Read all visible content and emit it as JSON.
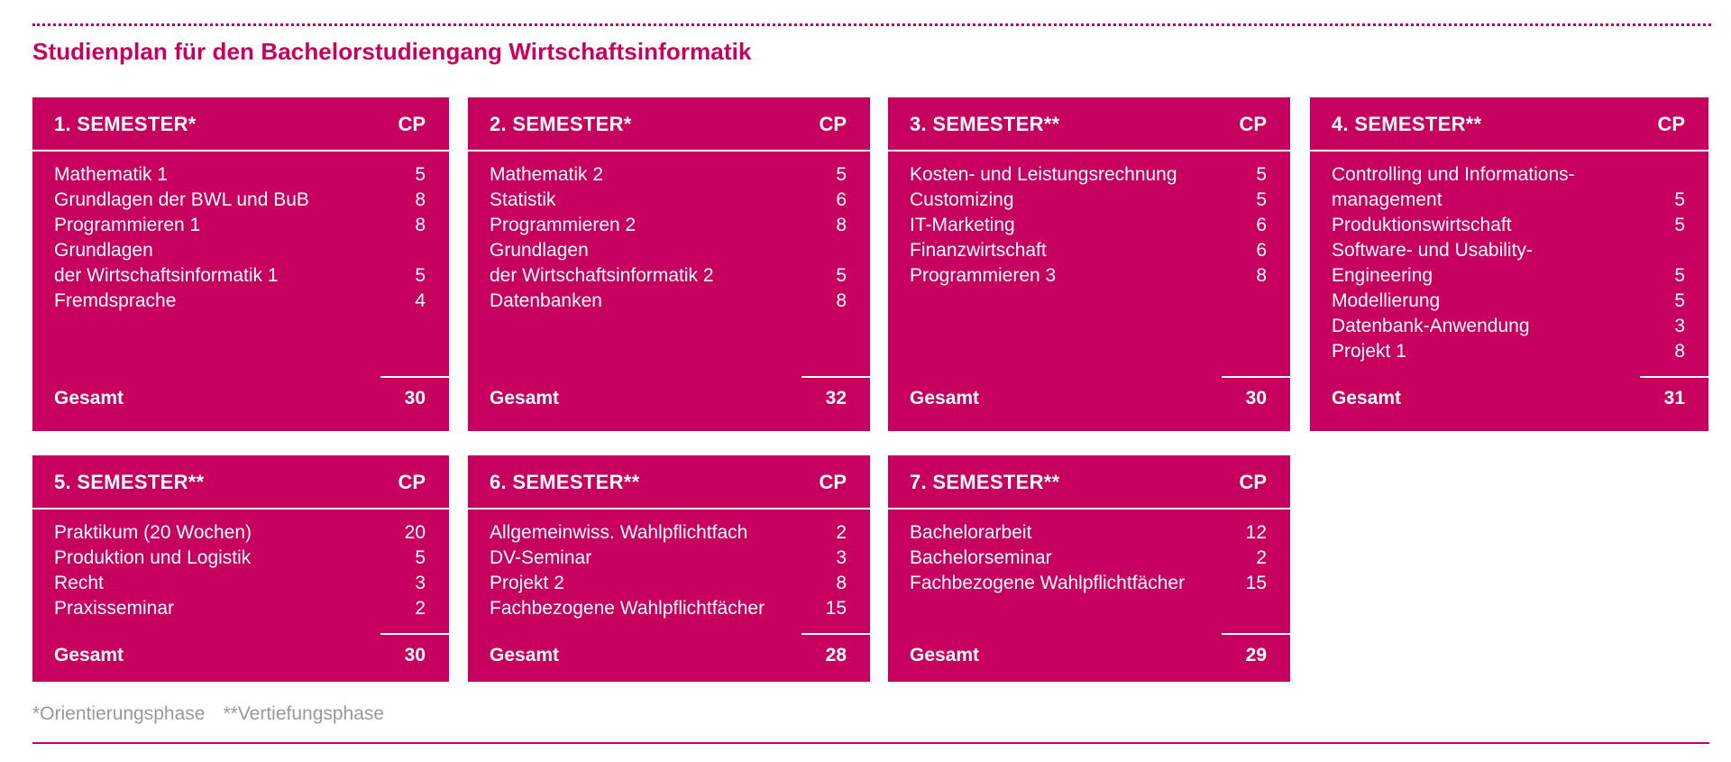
{
  "title": "Studienplan für den Bachelorstudiengang Wirtschaftsinformatik",
  "cp_header": "CP",
  "total_label": "Gesamt",
  "colors": {
    "accent": "#c7005f",
    "text_on_accent": "#ffffff",
    "footnote": "#999999"
  },
  "semesters": [
    {
      "title": "1. SEMESTER*",
      "courses": [
        {
          "name": "Mathematik 1",
          "cp": "5"
        },
        {
          "name": "Grundlagen der BWL und BuB",
          "cp": "8"
        },
        {
          "name": "Programmieren 1",
          "cp": "8"
        },
        {
          "name": "Grundlagen\nder Wirtschaftsinformatik 1",
          "cp": "5"
        },
        {
          "name": "Fremdsprache",
          "cp": "4"
        }
      ],
      "total": "30"
    },
    {
      "title": "2. SEMESTER*",
      "courses": [
        {
          "name": "Mathematik 2",
          "cp": "5"
        },
        {
          "name": "Statistik",
          "cp": "6"
        },
        {
          "name": "Programmieren 2",
          "cp": "8"
        },
        {
          "name": "Grundlagen\nder Wirtschaftsinformatik 2",
          "cp": "5"
        },
        {
          "name": "Datenbanken",
          "cp": "8"
        }
      ],
      "total": "32"
    },
    {
      "title": "3. SEMESTER**",
      "courses": [
        {
          "name": "Kosten- und Leistungsrechnung",
          "cp": "5"
        },
        {
          "name": "Customizing",
          "cp": "5"
        },
        {
          "name": "IT-Marketing",
          "cp": "6"
        },
        {
          "name": "Finanzwirtschaft",
          "cp": "6"
        },
        {
          "name": "Programmieren 3",
          "cp": "8"
        }
      ],
      "total": "30"
    },
    {
      "title": "4. SEMESTER**",
      "courses": [
        {
          "name": "Controlling und Informations-\nmanagement",
          "cp": "5"
        },
        {
          "name": "Produktionswirtschaft",
          "cp": "5"
        },
        {
          "name": "Software- und Usability-\nEngineering",
          "cp": "5"
        },
        {
          "name": "Modellierung",
          "cp": "5"
        },
        {
          "name": "Datenbank-Anwendung",
          "cp": "3"
        },
        {
          "name": "Projekt 1",
          "cp": "8"
        }
      ],
      "total": "31"
    },
    {
      "title": "5. SEMESTER**",
      "courses": [
        {
          "name": "Praktikum (20 Wochen)",
          "cp": "20"
        },
        {
          "name": "Produktion und Logistik",
          "cp": "5"
        },
        {
          "name": "Recht",
          "cp": "3"
        },
        {
          "name": "Praxisseminar",
          "cp": "2"
        }
      ],
      "total": "30"
    },
    {
      "title": "6. SEMESTER**",
      "courses": [
        {
          "name": "Allgemeinwiss. Wahlpflichtfach",
          "cp": "2"
        },
        {
          "name": "DV-Seminar",
          "cp": "3"
        },
        {
          "name": "Projekt 2",
          "cp": "8"
        },
        {
          "name": "Fachbezogene Wahlpflichtfächer",
          "cp": "15"
        }
      ],
      "total": "28"
    },
    {
      "title": "7. SEMESTER**",
      "courses": [
        {
          "name": "Bachelorarbeit",
          "cp": "12"
        },
        {
          "name": "Bachelorseminar",
          "cp": "2"
        },
        {
          "name": "Fachbezogene Wahlpflichtfächer",
          "cp": "15"
        }
      ],
      "total": "29"
    }
  ],
  "footnotes": {
    "orientation": "*Orientierungsphase",
    "specialization": "**Vertiefungsphase"
  }
}
